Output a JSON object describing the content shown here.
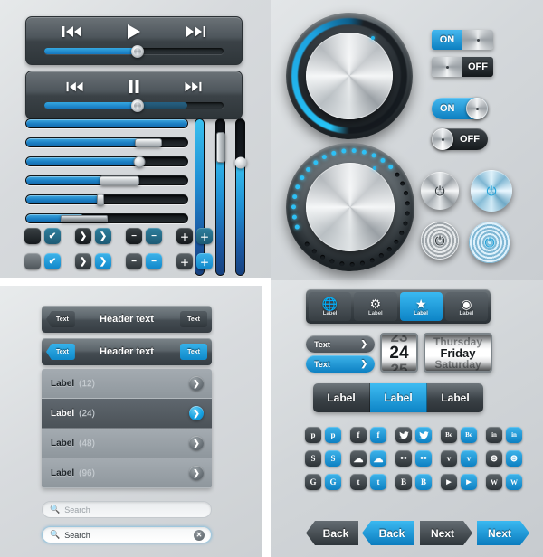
{
  "theme": {
    "accent_blue": "#1b9fd8",
    "accent_blue_light": "#3db3ea",
    "dark_gray": "#2d3337",
    "panel_bg": "#d9dcde"
  },
  "players": [
    {
      "name": "play-player",
      "prev_icon": "skip-backward-icon",
      "play_icon": "play-icon",
      "next_icon": "skip-forward-icon",
      "progress_percent": 52,
      "buffer_percent": 52
    },
    {
      "name": "pause-player",
      "prev_icon": "skip-backward-icon",
      "play_icon": "pause-icon",
      "next_icon": "skip-forward-icon",
      "progress_percent": 52,
      "buffer_percent": 80
    }
  ],
  "horizontal_sliders": [
    {
      "value_percent": 100,
      "thumb": "none"
    },
    {
      "value_percent": 76,
      "thumb": "wide"
    },
    {
      "value_percent": 70,
      "thumb": "round"
    },
    {
      "value_percent": 58,
      "thumb": "big"
    },
    {
      "value_percent": 46,
      "thumb": "narrow"
    },
    {
      "value_percent": 36,
      "thumb": "flat"
    }
  ],
  "vertical_sliders": [
    {
      "value_percent": 100,
      "thumb": "none"
    },
    {
      "value_percent": 82,
      "thumb": "tall"
    },
    {
      "value_percent": 72,
      "thumb": "round"
    }
  ],
  "square_buttons": {
    "row_top": [
      {
        "icon": "blank-icon",
        "glyph": "",
        "style": "darker"
      },
      {
        "icon": "check-icon",
        "glyph": "✔",
        "style": "teal"
      },
      {
        "icon": "chevron-right-icon",
        "glyph": "❯",
        "style": "darker"
      },
      {
        "icon": "chevron-right-icon",
        "glyph": "❯",
        "style": "teal"
      },
      {
        "icon": "minus-icon",
        "glyph": "−",
        "style": "darker"
      },
      {
        "icon": "minus-icon",
        "glyph": "−",
        "style": "teal"
      },
      {
        "icon": "plus-icon",
        "glyph": "＋",
        "style": "darker"
      },
      {
        "icon": "plus-icon",
        "glyph": "＋",
        "style": "teal"
      }
    ],
    "row_bottom": [
      {
        "icon": "blank-icon",
        "glyph": "",
        "style": "gray"
      },
      {
        "icon": "check-icon",
        "glyph": "✔",
        "style": "blue"
      },
      {
        "icon": "chevron-right-icon",
        "glyph": "❯",
        "style": "dark"
      },
      {
        "icon": "chevron-right-icon",
        "glyph": "❯",
        "style": "blue"
      },
      {
        "icon": "minus-icon",
        "glyph": "−",
        "style": "dark"
      },
      {
        "icon": "minus-icon",
        "glyph": "−",
        "style": "blue"
      },
      {
        "icon": "plus-icon",
        "glyph": "＋",
        "style": "dark"
      },
      {
        "icon": "plus-icon",
        "glyph": "＋",
        "style": "blue"
      }
    ]
  },
  "nav_headers": [
    {
      "back_label": "Text",
      "title": "Header text",
      "action_label": "Text",
      "variant": "dark"
    },
    {
      "back_label": "Text",
      "title": "Header text",
      "action_label": "Text",
      "variant": "blue"
    }
  ],
  "list": {
    "rows": [
      {
        "label": "Label",
        "count": "(12)",
        "selected": false
      },
      {
        "label": "Label",
        "count": "(24)",
        "selected": true
      },
      {
        "label": "Label",
        "count": "(48)",
        "selected": false
      },
      {
        "label": "Label",
        "count": "(96)",
        "selected": false
      }
    ],
    "chevron_icon": "chevron-right-icon"
  },
  "search_fields": [
    {
      "placeholder": "Search",
      "value": "",
      "icon": "search-icon",
      "focused": false,
      "has_clear": false
    },
    {
      "placeholder": "Search",
      "value": "Search",
      "icon": "search-icon",
      "focused": true,
      "has_clear": true,
      "clear_icon": "clear-circle-icon"
    }
  ],
  "knobs": [
    {
      "name": "arc-volume-knob",
      "indicator_icon": "led-dot-icon",
      "style": "smooth-arc"
    },
    {
      "name": "beaded-volume-knob",
      "indicator_icon": "led-dot-icon",
      "style": "led-beads",
      "lit_beads": 16,
      "total_beads": 34
    }
  ],
  "switches": [
    {
      "name": "rect-switch-on",
      "label": "ON",
      "state": "on",
      "shape": "rect"
    },
    {
      "name": "rect-switch-off",
      "label": "OFF",
      "state": "off",
      "shape": "rect"
    },
    {
      "name": "pill-switch-on",
      "label": "ON",
      "state": "on",
      "shape": "pill"
    },
    {
      "name": "pill-switch-off",
      "label": "OFF",
      "state": "off",
      "shape": "pill"
    }
  ],
  "metal_buttons": [
    {
      "name": "power-button-silver",
      "icon": "power-icon",
      "glyph": "⏻",
      "finish": "brushed",
      "lit": false
    },
    {
      "name": "power-button-blue",
      "icon": "power-icon",
      "glyph": "⏻",
      "finish": "brushed",
      "lit": true
    },
    {
      "name": "power-button-ringed",
      "icon": "power-icon",
      "glyph": "⏻",
      "finish": "ringed",
      "lit": false
    },
    {
      "name": "power-button-ringed-blue",
      "icon": "power-icon",
      "glyph": "⏻",
      "finish": "ringed",
      "lit": true
    }
  ],
  "tab_bar": {
    "tabs": [
      {
        "icon": "globe-icon",
        "glyph": "🌐",
        "label": "Label",
        "active": false
      },
      {
        "icon": "gear-icon",
        "glyph": "⚙",
        "label": "Label",
        "active": false
      },
      {
        "icon": "star-icon",
        "glyph": "★",
        "label": "Label",
        "active": true
      },
      {
        "icon": "record-icon",
        "glyph": "◉",
        "label": "Label",
        "active": false
      }
    ]
  },
  "text_pills": [
    {
      "label": "Text",
      "arrow_icon": "chevron-right-icon",
      "arrow": "❯",
      "variant": "dark"
    },
    {
      "label": "Text",
      "arrow_icon": "chevron-right-icon",
      "arrow": "❯",
      "variant": "blue"
    }
  ],
  "pickers": [
    {
      "name": "day-number-picker",
      "above": "23",
      "selected": "24",
      "below": "25"
    },
    {
      "name": "weekday-picker",
      "above": "Thursday",
      "selected": "Friday",
      "below": "Saturday"
    }
  ],
  "segmented_control": {
    "segments": [
      {
        "label": "Label",
        "active": false
      },
      {
        "label": "Label",
        "active": true
      },
      {
        "label": "Label",
        "active": false
      }
    ]
  },
  "social_icons": {
    "rows": [
      [
        {
          "name": "pinterest",
          "glyph": "p"
        },
        {
          "name": "facebook",
          "glyph": "f"
        },
        {
          "name": "twitter",
          "glyph": "ᵗ"
        },
        {
          "name": "behance",
          "glyph": "Bє"
        },
        {
          "name": "linkedin",
          "glyph": "in"
        }
      ],
      [
        {
          "name": "skype",
          "glyph": "S"
        },
        {
          "name": "icloud",
          "glyph": "☁"
        },
        {
          "name": "flickr",
          "glyph": "••"
        },
        {
          "name": "vimeo",
          "glyph": "v"
        },
        {
          "name": "dribbble",
          "glyph": "⊛"
        }
      ],
      [
        {
          "name": "google",
          "glyph": "G"
        },
        {
          "name": "tumblr",
          "glyph": "t"
        },
        {
          "name": "blogger",
          "glyph": "B"
        },
        {
          "name": "youtube",
          "glyph": "▶"
        },
        {
          "name": "wordpress",
          "glyph": "W"
        }
      ]
    ]
  },
  "nav_buttons": [
    {
      "label": "Back",
      "direction": "back",
      "variant": "dark"
    },
    {
      "label": "Back",
      "direction": "back",
      "variant": "blue"
    },
    {
      "label": "Next",
      "direction": "next",
      "variant": "dark"
    },
    {
      "label": "Next",
      "direction": "next",
      "variant": "blue"
    }
  ]
}
